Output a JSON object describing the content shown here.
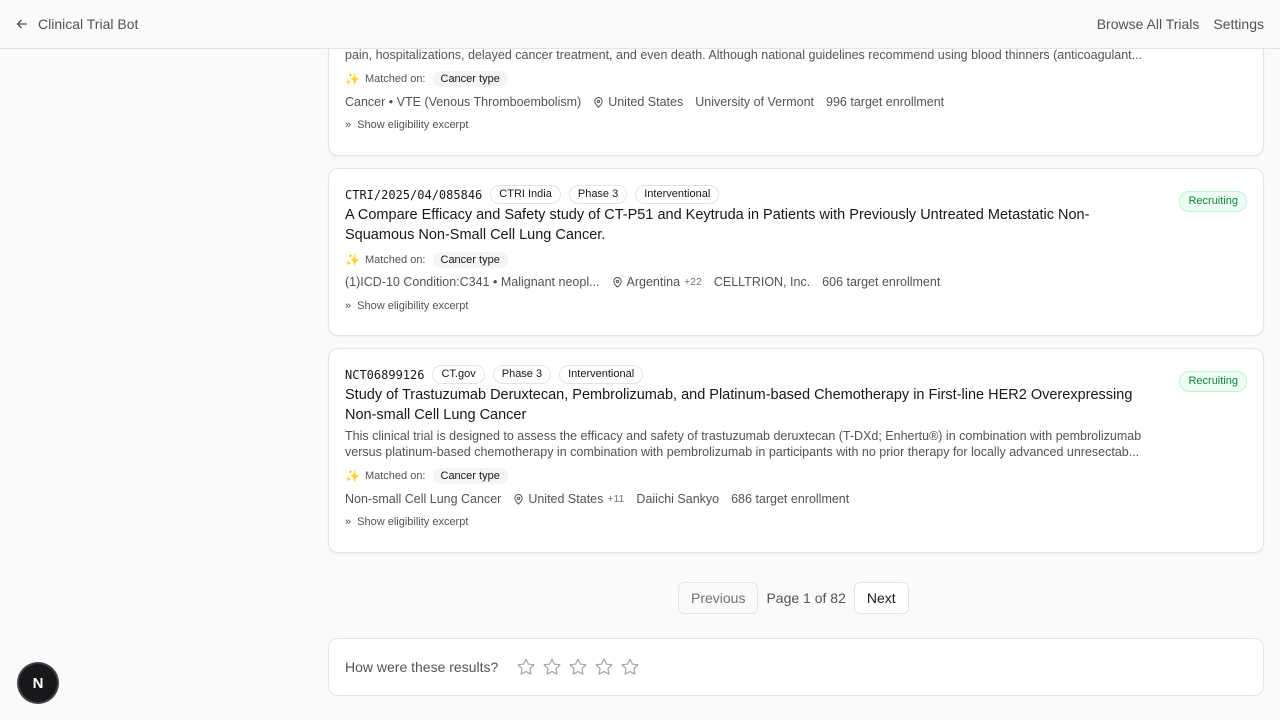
{
  "header": {
    "back_label": "Clinical Trial Bot",
    "nav": [
      "Browse All Trials",
      "Settings"
    ]
  },
  "cards": [
    {
      "desc": "pain, hospitalizations, delayed cancer treatment, and even death. Although national guidelines recommend using blood thinners (anticoagulant...",
      "matched_label": "Matched on:",
      "matched_on": "Cancer type",
      "condition": "Cancer • VTE (Venous Thromboembolism)",
      "location": "United States",
      "sponsor": "University of Vermont",
      "enrollment": "996 target enrollment",
      "eligibility": "Show eligibility excerpt"
    },
    {
      "id": "CTRI/2025/04/085846",
      "registry": "CTRI India",
      "phase": "Phase 3",
      "type": "Interventional",
      "status": "Recruiting",
      "title": "A Compare Efficacy and Safety study of CT-P51 and Keytruda in Patients with Previously Untreated Metastatic Non-Squamous Non-Small Cell Lung Cancer.",
      "matched_label": "Matched on:",
      "matched_on": "Cancer type",
      "condition": "(1)ICD-10 Condition:C341 • Malignant neopl...",
      "location": "Argentina",
      "location_more": "+22",
      "sponsor": "CELLTRION, Inc.",
      "enrollment": "606 target enrollment",
      "eligibility": "Show eligibility excerpt"
    },
    {
      "id": "NCT06899126",
      "registry": "CT.gov",
      "phase": "Phase 3",
      "type": "Interventional",
      "status": "Recruiting",
      "title": "Study of Trastuzumab Deruxtecan, Pembrolizumab, and Platinum-based Chemotherapy in First-line HER2 Overexpressing Non-small Cell Lung Cancer",
      "desc1": "This clinical trial is designed to assess the efficacy and safety of trastuzumab deruxtecan (T-DXd; Enhertu®) in combination with pembrolizumab",
      "desc2": "versus platinum-based chemotherapy in combination with pembrolizumab in participants with no prior therapy for locally advanced unresectab...",
      "matched_label": "Matched on:",
      "matched_on": "Cancer type",
      "condition": "Non-small Cell Lung Cancer",
      "location": "United States",
      "location_more": "+11",
      "sponsor": "Daiichi Sankyo",
      "enrollment": "686 target enrollment",
      "eligibility": "Show eligibility excerpt"
    }
  ],
  "pagination": {
    "previous": "Previous",
    "info": "Page 1 of 82",
    "next": "Next"
  },
  "feedback": {
    "question": "How were these results?",
    "stars_total": 5
  },
  "badge": "N",
  "colors": {
    "recruiting_bg": "#ecfdf3",
    "recruiting_text": "#15803d",
    "spark": "#d97706"
  }
}
